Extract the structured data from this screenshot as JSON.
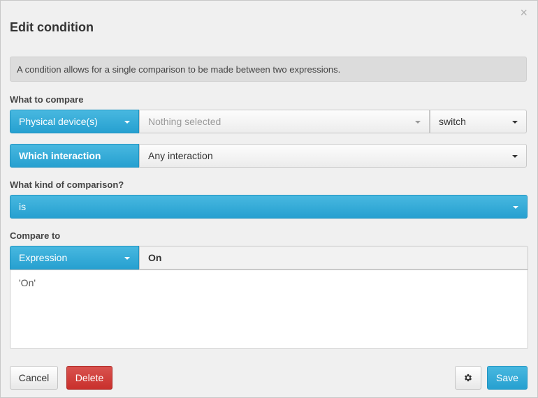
{
  "dialog": {
    "title": "Edit condition",
    "close_glyph": "×",
    "info_text": "A condition allows for a single comparison to be made between two expressions."
  },
  "compare": {
    "label": "What to compare",
    "source_dropdown": "Physical device(s)",
    "device_select_placeholder": "Nothing selected",
    "type_select": "switch"
  },
  "interaction": {
    "label": "Which interaction",
    "value": "Any interaction"
  },
  "comparison": {
    "label": "What kind of comparison?",
    "operator": "is"
  },
  "compare_to": {
    "label": "Compare to",
    "mode_dropdown": "Expression",
    "preview_value": "On",
    "expression_text": "'On'"
  },
  "footer": {
    "cancel_label": "Cancel",
    "delete_label": "Delete",
    "settings_icon": "gear-icon",
    "save_label": "Save"
  },
  "colors": {
    "primary": "#2ca7d6",
    "danger": "#d0403b",
    "background": "#f0f0f0"
  }
}
